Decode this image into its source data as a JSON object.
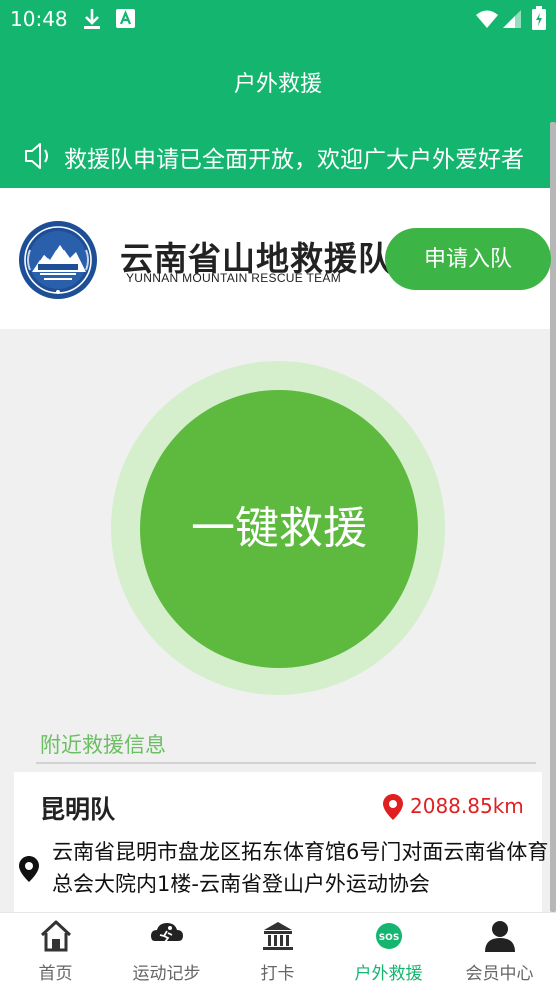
{
  "status_bar": {
    "time": "10:48"
  },
  "header": {
    "title": "户外救援"
  },
  "notice": {
    "text": "救援队申请已全面开放，欢迎广大户外爱好者"
  },
  "team": {
    "name": "云南省山地救援队",
    "name_en": "YUNNAN MOUNTAIN RESCUE TEAM",
    "logo_text": "云南省山地救援队",
    "join_label": "申请入队"
  },
  "sos": {
    "label": "一键救援"
  },
  "nearby": {
    "title": "附近救援信息",
    "items": [
      {
        "name": "昆明队",
        "distance": "2088.85km",
        "address": "云南省昆明市盘龙区拓东体育馆6号门对面云南省体育总会大院内1楼-云南省登山户外运动协会"
      }
    ]
  },
  "tabbar": {
    "tabs": [
      {
        "label": "首页",
        "icon": "home-icon"
      },
      {
        "label": "运动记步",
        "icon": "running-icon"
      },
      {
        "label": "打卡",
        "icon": "checkin-icon"
      },
      {
        "label": "户外救援",
        "icon": "sos-icon"
      },
      {
        "label": "会员中心",
        "icon": "person-icon"
      }
    ]
  },
  "colors": {
    "primary": "#14b66f",
    "accent_green": "#5eb93f",
    "button_green": "#3db446",
    "distance_red": "#e02020"
  }
}
